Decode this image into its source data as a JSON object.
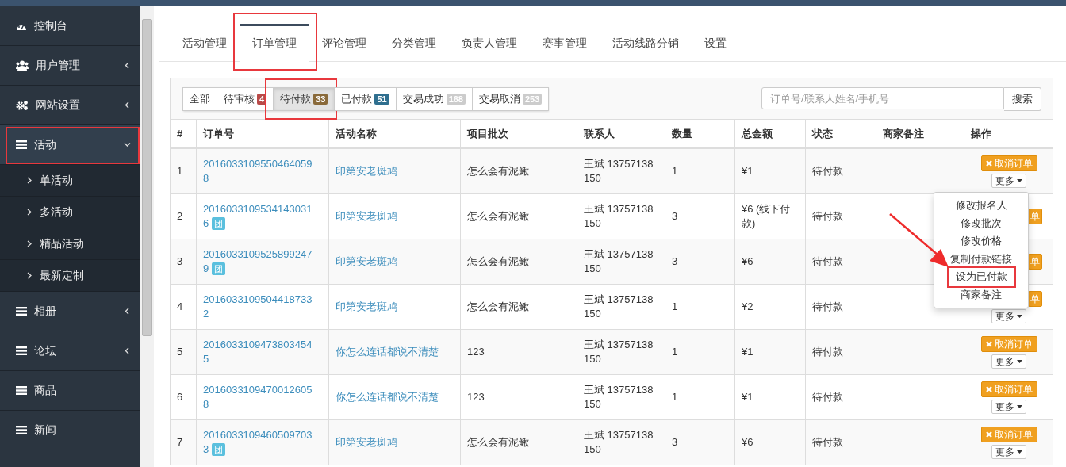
{
  "sidebar": {
    "items": [
      {
        "label": "控制台",
        "kind": "dashboard",
        "has_submenu": false,
        "expanded": false,
        "annotated": false
      },
      {
        "label": "用户管理",
        "kind": "users",
        "has_submenu": true,
        "expanded": false,
        "annotated": false
      },
      {
        "label": "网站设置",
        "kind": "cogs",
        "has_submenu": true,
        "expanded": false,
        "annotated": false
      },
      {
        "label": "活动",
        "kind": "bars",
        "has_submenu": true,
        "expanded": true,
        "annotated": true,
        "children": [
          {
            "label": "单活动"
          },
          {
            "label": "多活动"
          },
          {
            "label": "精品活动"
          },
          {
            "label": "最新定制"
          }
        ]
      },
      {
        "label": "相册",
        "kind": "bars",
        "has_submenu": true,
        "expanded": false,
        "annotated": false
      },
      {
        "label": "论坛",
        "kind": "bars",
        "has_submenu": true,
        "expanded": false,
        "annotated": false
      },
      {
        "label": "商品",
        "kind": "bars",
        "has_submenu": false,
        "expanded": false,
        "annotated": false
      },
      {
        "label": "新闻",
        "kind": "bars",
        "has_submenu": false,
        "expanded": false,
        "annotated": false
      }
    ]
  },
  "tabs": [
    {
      "label": "活动管理",
      "selected": false,
      "annotated": false
    },
    {
      "label": "订单管理",
      "selected": true,
      "annotated": true
    },
    {
      "label": "评论管理",
      "selected": false,
      "annotated": false
    },
    {
      "label": "分类管理",
      "selected": false,
      "annotated": false
    },
    {
      "label": "负责人管理",
      "selected": false,
      "annotated": false
    },
    {
      "label": "赛事管理",
      "selected": false,
      "annotated": false
    },
    {
      "label": "活动线路分销",
      "selected": false,
      "annotated": false
    },
    {
      "label": "设置",
      "selected": false,
      "annotated": false
    }
  ],
  "filters": [
    {
      "label": "全部",
      "selected": false,
      "annotated": false
    },
    {
      "label": "待审核",
      "count": "4",
      "color": "#b94a48",
      "selected": false,
      "annotated": false
    },
    {
      "label": "待付款",
      "count": "33",
      "color": "#8a6a3a",
      "selected": true,
      "annotated": true
    },
    {
      "label": "已付款",
      "count": "51",
      "color": "#2f6f8f",
      "selected": false,
      "annotated": false
    },
    {
      "label": "交易成功",
      "count": "168",
      "color": "#cccccc",
      "selected": false,
      "annotated": false
    },
    {
      "label": "交易取消",
      "count": "253",
      "color": "#cccccc",
      "selected": false,
      "annotated": false
    }
  ],
  "search": {
    "placeholder": "订单号/联系人姓名/手机号",
    "button": "搜索"
  },
  "table": {
    "columns": [
      "#",
      "订单号",
      "活动名称",
      "项目批次",
      "联系人",
      "数量",
      "总金额",
      "状态",
      "商家备注",
      "操作"
    ],
    "rows": [
      {
        "index": "1",
        "order_no": [
          "2016033109550464059",
          "8"
        ],
        "activity": "印第安老斑鸠",
        "batch": "怎么会有泥鳅",
        "contact": "王斌 13757138150",
        "quantity": "1",
        "total": "¥1",
        "status": "待付款",
        "actions": [
          {
            "kind": "cancel",
            "label": "取消订单"
          },
          {
            "kind": "more",
            "label": "更多"
          }
        ]
      },
      {
        "index": "2",
        "order_no": [
          "2016033109534143031",
          "6"
        ],
        "tag": "团",
        "activity": "印第安老斑鸠",
        "batch": "怎么会有泥鳅",
        "contact": "王斌 13757138150",
        "quantity": "3",
        "total": "¥6 (线下付款)",
        "status": "待付款",
        "actions": [
          {
            "kind": "cancel_clipped",
            "label": "单"
          }
        ]
      },
      {
        "index": "3",
        "order_no": [
          "2016033109525899247",
          "9"
        ],
        "tag": "团",
        "activity": "印第安老斑鸠",
        "batch": "怎么会有泥鳅",
        "contact": "王斌 13757138150",
        "quantity": "3",
        "total": "¥6",
        "status": "待付款",
        "actions": [
          {
            "kind": "cancel_clipped",
            "label": "单"
          }
        ]
      },
      {
        "index": "4",
        "order_no": [
          "2016033109504418733",
          "2"
        ],
        "activity": "印第安老斑鸠",
        "batch": "怎么会有泥鳅",
        "contact": "王斌 13757138150",
        "quantity": "1",
        "total": "¥2",
        "status": "待付款",
        "actions": [
          {
            "kind": "cancel_clipped",
            "label": "单"
          },
          {
            "kind": "more",
            "label": "更多"
          }
        ]
      },
      {
        "index": "5",
        "order_no": [
          "2016033109473803454",
          "5"
        ],
        "activity": "你怎么连话都说不清楚",
        "batch": "123",
        "contact": "王斌 13757138150",
        "quantity": "1",
        "total": "¥1",
        "status": "待付款",
        "actions": [
          {
            "kind": "cancel",
            "label": "取消订单"
          },
          {
            "kind": "more",
            "label": "更多"
          }
        ]
      },
      {
        "index": "6",
        "order_no": [
          "2016033109470012605",
          "8"
        ],
        "activity": "你怎么连话都说不清楚",
        "batch": "123",
        "contact": "王斌 13757138150",
        "quantity": "1",
        "total": "¥1",
        "status": "待付款",
        "actions": [
          {
            "kind": "cancel",
            "label": "取消订单"
          },
          {
            "kind": "more",
            "label": "更多"
          }
        ]
      },
      {
        "index": "7",
        "order_no": [
          "2016033109460509703",
          "3"
        ],
        "tag": "团",
        "activity": "印第安老斑鸠",
        "batch": "怎么会有泥鳅",
        "contact": "王斌 13757138150",
        "quantity": "3",
        "total": "¥6",
        "status": "待付款",
        "actions": [
          {
            "kind": "cancel",
            "label": "取消订单"
          },
          {
            "kind": "more",
            "label": "更多"
          }
        ]
      }
    ]
  },
  "dropdown_menu": {
    "items": [
      {
        "label": "修改报名人",
        "annotated": false
      },
      {
        "label": "修改批次",
        "annotated": false
      },
      {
        "label": "修改价格",
        "annotated": false
      },
      {
        "label": "复制付款链接",
        "annotated": false
      },
      {
        "label": "设为已付款",
        "annotated": true
      },
      {
        "label": "商家备注",
        "annotated": false
      }
    ]
  }
}
